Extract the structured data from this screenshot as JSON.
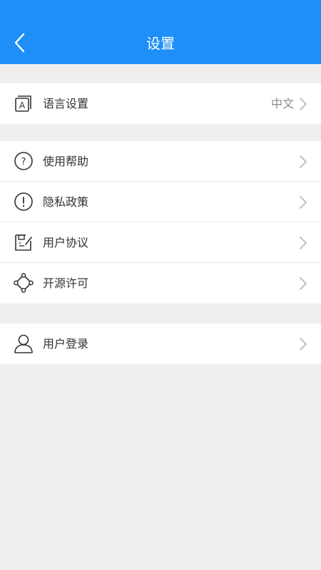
{
  "header": {
    "title": "设置",
    "back_icon": "chevron-left-icon",
    "bg_color": "#1d8ff7"
  },
  "groups": [
    {
      "items": [
        {
          "label": "语言设置",
          "value": "中文",
          "icon": "language-icon"
        }
      ]
    },
    {
      "items": [
        {
          "label": "使用帮助",
          "icon": "help-icon"
        },
        {
          "label": "隐私政策",
          "icon": "privacy-icon"
        },
        {
          "label": "用户协议",
          "icon": "agreement-icon"
        },
        {
          "label": "开源许可",
          "icon": "open-source-icon"
        }
      ]
    },
    {
      "items": [
        {
          "label": "用户登录",
          "icon": "user-icon"
        }
      ]
    }
  ],
  "colors": {
    "background": "#efefef",
    "text": "#333333",
    "secondary_text": "#8a8a8a",
    "chevron": "#b5b5b5"
  }
}
